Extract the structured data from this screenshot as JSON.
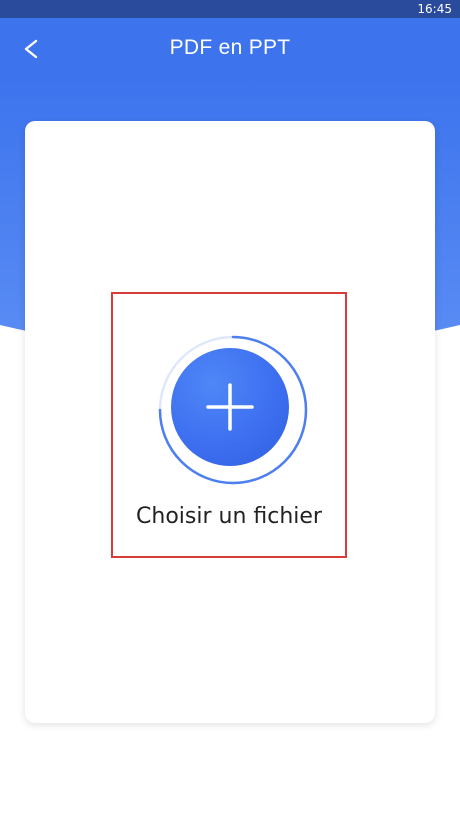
{
  "status_bar": {
    "time": "16:45"
  },
  "app_bar": {
    "title": "PDF en PPT",
    "back_icon": "chevron-left-icon"
  },
  "file_picker": {
    "label": "Choisir un fichier",
    "icon": "plus-icon"
  },
  "colors": {
    "primary": "#3d74ee",
    "status_bar": "#2a4b9c",
    "highlight_border": "#d93a3a"
  }
}
